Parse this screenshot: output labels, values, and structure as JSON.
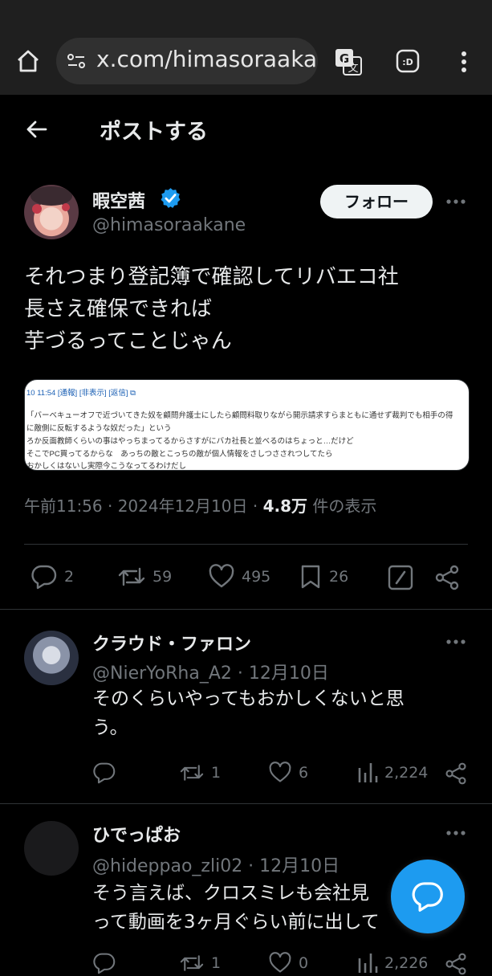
{
  "browser": {
    "url": "x.com/himasoraakar",
    "ext_label": ":D",
    "icons": [
      "home-icon",
      "site-settings-icon",
      "translate-icon",
      "extension-icon",
      "kebab-menu-icon"
    ]
  },
  "header": {
    "title": "ポストする"
  },
  "post": {
    "author_name": "暇空茜",
    "author_handle": "@himasoraakane",
    "follow_label": "フォロー",
    "text_lines": [
      "それつまり登記簿で確認してリバエコ社",
      "長さえ確保できれば",
      "芋づるってことじゃん"
    ],
    "screenshot": {
      "header": "10 11:54 [通報] [非表示] [返信] ⧉",
      "lines": [
        "「バーベキューオフで近づいてきた奴を顧問弁護士にしたら顧問料取りながら開示請求すらまともに通せず裁判でも相手の得",
        "に敵側に反転するような奴だった」という",
        "ろか反面教師くらいの事はやっちまってるからさすがにバカ社長と並べるのはちょっと…だけど",
        "そこでPC買ってるからな　あっちの敵とこっちの敵が個人情報をさしつさされつしてたら",
        "おかしくはないし実際今こうなってるわけだし"
      ]
    },
    "meta_time": "午前11:56 · 2024年12月10日 · ",
    "meta_views": "4.8万",
    "meta_views_label": " 件の表示",
    "stats": {
      "replies": "2",
      "reposts": "59",
      "likes": "495",
      "bookmarks": "26"
    }
  },
  "replies": [
    {
      "name": "クラウド・ファロン",
      "handle": "@NierYoRha_A2 · 12月10日",
      "text_lines": [
        "そのくらいやってもおかしくないと思",
        "う。"
      ],
      "stats": {
        "replies": "",
        "reposts": "1",
        "likes": "6",
        "views": "2,224"
      }
    },
    {
      "name": "ひでっぱお",
      "handle": "@hideppao_zli02 · 12月10日",
      "text_lines": [
        "そう言えば、クロスミレも会社見",
        "って動画を3ヶ月ぐらい前に出して"
      ],
      "stats": {
        "replies": "",
        "reposts": "1",
        "likes": "0",
        "views": "2,226"
      }
    }
  ],
  "colors": {
    "background": "#000000",
    "accent": "#1d9bf0",
    "muted": "#71767b",
    "text": "#e7e9ea"
  }
}
